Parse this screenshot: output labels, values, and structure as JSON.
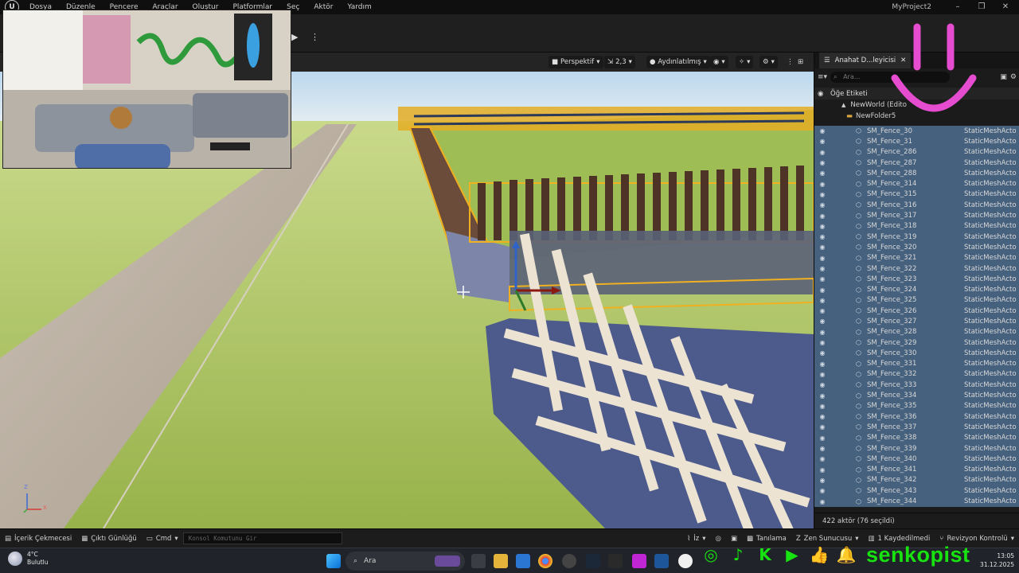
{
  "menu": {
    "items": [
      "Dosya",
      "Düzenle",
      "Pencere",
      "Araçlar",
      "Oluştur",
      "Platformlar",
      "Seç",
      "Aktör",
      "Yardım"
    ],
    "project_name": "MyProject2"
  },
  "viewport": {
    "view_mode": "Perspektif",
    "fov_value": "2,3",
    "lighting_mode": "Aydınlatılmış",
    "axis_labels": {
      "x": "X",
      "z": "Z"
    }
  },
  "outliner": {
    "tab_title": "Anahat D...leyicisi",
    "search_placeholder": "Ara...",
    "column_label": "Öğe Etiketi",
    "world_label": "NewWorld (Edito",
    "folder_label": "NewFolder5",
    "rows": [
      {
        "name": "SM_Fence_30",
        "type": "StaticMeshActo"
      },
      {
        "name": "SM_Fence_31",
        "type": "StaticMeshActo"
      },
      {
        "name": "SM_Fence_286",
        "type": "StaticMeshActo"
      },
      {
        "name": "SM_Fence_287",
        "type": "StaticMeshActo"
      },
      {
        "name": "SM_Fence_288",
        "type": "StaticMeshActo"
      },
      {
        "name": "SM_Fence_314",
        "type": "StaticMeshActo"
      },
      {
        "name": "SM_Fence_315",
        "type": "StaticMeshActo"
      },
      {
        "name": "SM_Fence_316",
        "type": "StaticMeshActo"
      },
      {
        "name": "SM_Fence_317",
        "type": "StaticMeshActo"
      },
      {
        "name": "SM_Fence_318",
        "type": "StaticMeshActo"
      },
      {
        "name": "SM_Fence_319",
        "type": "StaticMeshActo"
      },
      {
        "name": "SM_Fence_320",
        "type": "StaticMeshActo"
      },
      {
        "name": "SM_Fence_321",
        "type": "StaticMeshActo"
      },
      {
        "name": "SM_Fence_322",
        "type": "StaticMeshActo"
      },
      {
        "name": "SM_Fence_323",
        "type": "StaticMeshActo"
      },
      {
        "name": "SM_Fence_324",
        "type": "StaticMeshActo"
      },
      {
        "name": "SM_Fence_325",
        "type": "StaticMeshActo"
      },
      {
        "name": "SM_Fence_326",
        "type": "StaticMeshActo"
      },
      {
        "name": "SM_Fence_327",
        "type": "StaticMeshActo"
      },
      {
        "name": "SM_Fence_328",
        "type": "StaticMeshActo"
      },
      {
        "name": "SM_Fence_329",
        "type": "StaticMeshActo"
      },
      {
        "name": "SM_Fence_330",
        "type": "StaticMeshActo"
      },
      {
        "name": "SM_Fence_331",
        "type": "StaticMeshActo"
      },
      {
        "name": "SM_Fence_332",
        "type": "StaticMeshActo"
      },
      {
        "name": "SM_Fence_333",
        "type": "StaticMeshActo"
      },
      {
        "name": "SM_Fence_334",
        "type": "StaticMeshActo"
      },
      {
        "name": "SM_Fence_335",
        "type": "StaticMeshActo"
      },
      {
        "name": "SM_Fence_336",
        "type": "StaticMeshActo"
      },
      {
        "name": "SM_Fence_337",
        "type": "StaticMeshActo"
      },
      {
        "name": "SM_Fence_338",
        "type": "StaticMeshActo"
      },
      {
        "name": "SM_Fence_339",
        "type": "StaticMeshActo"
      },
      {
        "name": "SM_Fence_340",
        "type": "StaticMeshActo"
      },
      {
        "name": "SM_Fence_341",
        "type": "StaticMeshActo"
      },
      {
        "name": "SM_Fence_342",
        "type": "StaticMeshActo"
      },
      {
        "name": "SM_Fence_343",
        "type": "StaticMeshActo"
      },
      {
        "name": "SM_Fence_344",
        "type": "StaticMeshActo"
      }
    ],
    "footer": "422 aktör (76 seçildi)"
  },
  "statusbar": {
    "content_drawer": "İçerik Çekmecesi",
    "output_log": "Çıktı Günlüğü",
    "cmd": "Cmd",
    "console_placeholder": "Konsol Komutunu Gir",
    "iz": "İz",
    "diagnostics": "Tanılama",
    "zen_server": "Zen Sunucusu",
    "saved": "1 Kaydedilmedi",
    "revision": "Revizyon Kontrolü"
  },
  "taskbar": {
    "temperature": "4°C",
    "weather": "Bulutlu",
    "search_label": "Ara",
    "time": "13:05",
    "date": "31.12.2025"
  },
  "social": {
    "handle": "senkopist"
  },
  "colors": {
    "selection_row": "#46617e",
    "social_green": "#18e20f",
    "smile_pink": "#e64ccf",
    "grass": "#a8c058"
  }
}
